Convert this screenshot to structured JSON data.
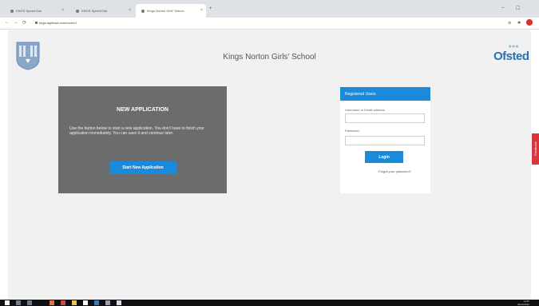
{
  "browser": {
    "tabs": [
      {
        "label": "KNGS Speed Dial",
        "active": false
      },
      {
        "label": "KNGS Speed Dial",
        "active": false
      },
      {
        "label": "Kings Norton Girls' School",
        "active": true
      }
    ],
    "new_tab": "+",
    "url": "kngs.applicaa.com/core/v1",
    "min": "–",
    "restore": "☐"
  },
  "site": {
    "title": "Kings Norton Girls' School",
    "ofsted_logo_text": "Ofsted",
    "ofsted_stars": "★★★"
  },
  "new_application": {
    "heading": "NEW APPLICATION",
    "description": "Use the button below to start a new application. You don't have to finish your application immediately. You can save it and continue later.",
    "button_label": "Start New Application"
  },
  "login": {
    "heading": "Registered Users",
    "username_label": "Username or Email address",
    "username_value": "",
    "password_label": "Password",
    "password_value": "",
    "button_label": "Login",
    "forgot_link": "Forgot your password?"
  },
  "feedback_tab": "Feedback",
  "taskbar": {
    "time": "14:25",
    "date": "26/11/2020"
  },
  "colors": {
    "accent": "#1a8bdb",
    "panel": "#6b6c6e",
    "page_bg": "#f1f1f2",
    "feedback": "#d9363e"
  }
}
